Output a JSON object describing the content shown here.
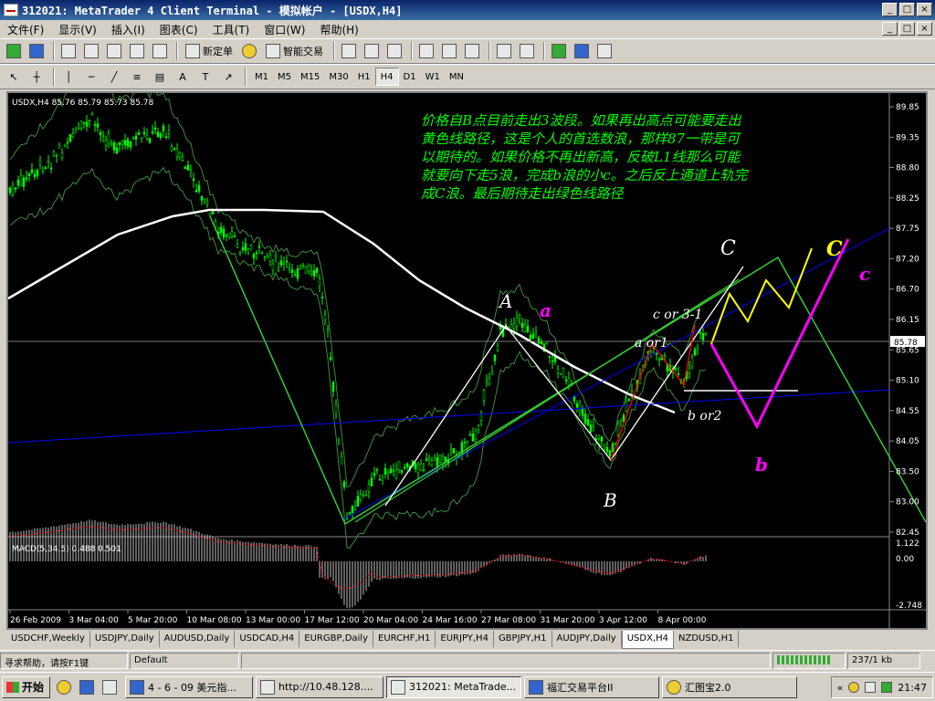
{
  "window": {
    "title": "312021: MetaTrader 4 Client Terminal - 模拟帐户 - [USDX,H4]",
    "min": "_",
    "max": "□",
    "close": "×"
  },
  "menu": [
    "文件(F)",
    "显示(V)",
    "插入(I)",
    "图表(C)",
    "工具(T)",
    "窗口(W)",
    "帮助(H)"
  ],
  "toolbar": {
    "new_order": "新定单",
    "expert": "智能交易"
  },
  "timeframes": [
    "M1",
    "M5",
    "M15",
    "M30",
    "H1",
    "H4",
    "D1",
    "W1",
    "MN"
  ],
  "active_timeframe": "H4",
  "chart": {
    "header": "USDX,H4  85.76 85.79 85.73 85.78",
    "macd_header": "MACD(5,34,5) 0.488 0.501",
    "annotation_lines": [
      "价格自B点目前走出3波段。如果再出高点可能要走出",
      "黄色线路径，这是个人的首选数浪，那样87一带是可",
      "以期待的。如果价格不再出新高，反破L1线那么可能",
      "就要向下走5浪，完成b浪的小c。之后反上通道上轨完",
      "成C浪。最后期待走出绿色线路径"
    ],
    "labels": {
      "A": "A",
      "a": "a",
      "B": "B",
      "b": "b",
      "C_white": "C",
      "C_yellow": "C",
      "c": "c",
      "c_or_3": "c  or 3-1",
      "a_or1": "a  or1",
      "b_or2": "b  or2"
    },
    "price_axis": [
      "89.85",
      "89.35",
      "88.80",
      "88.25",
      "87.75",
      "87.20",
      "86.70",
      "86.15",
      "85.65",
      "85.10",
      "84.55",
      "84.05",
      "83.50",
      "83.00",
      "82.45"
    ],
    "current_price": "85.78",
    "macd_axis": [
      "1.122",
      "0.00",
      "-2.748"
    ],
    "time_axis": [
      "26 Feb 2009",
      "3 Mar 04:00",
      "5 Mar 20:00",
      "10 Mar 08:00",
      "13 Mar 00:00",
      "17 Mar 12:00",
      "20 Mar 04:00",
      "24 Mar 16:00",
      "27 Mar 08:00",
      "31 Mar 20:00",
      "3 Apr 12:00",
      "8 Apr 00:00"
    ],
    "colors": {
      "candle": "#00ff00",
      "ma": "#ffffff",
      "bands": "#3c8c3c",
      "channel": "#0000ff",
      "text": "#00ff00",
      "yellow": "#ffff00",
      "magenta": "#ff00ff",
      "red": "#ff0000",
      "macd": "#c0c0c0",
      "signal": "#ff0000"
    }
  },
  "tabs": [
    "USDCHF,Weekly",
    "USDJPY,Daily",
    "AUDUSD,Daily",
    "USDCAD,H4",
    "EURGBP,Daily",
    "EURCHF,H1",
    "EURJPY,H4",
    "GBPJPY,H1",
    "AUDJPY,Daily",
    "USDX,H4",
    "NZDUSD,H1"
  ],
  "active_tab": "USDX,H4",
  "status": {
    "help": "寻求帮助，请按F1键",
    "profile": "Default",
    "traffic": "237/1 kb"
  },
  "taskbar": {
    "start": "开始",
    "tasks": [
      "4 - 6 - 09 美元指...",
      "http://10.48.128....",
      "312021: MetaTrade...",
      "福汇交易平台II",
      "汇图宝2.0"
    ],
    "active_task": "312021: MetaTrade...",
    "time": "21:47"
  }
}
